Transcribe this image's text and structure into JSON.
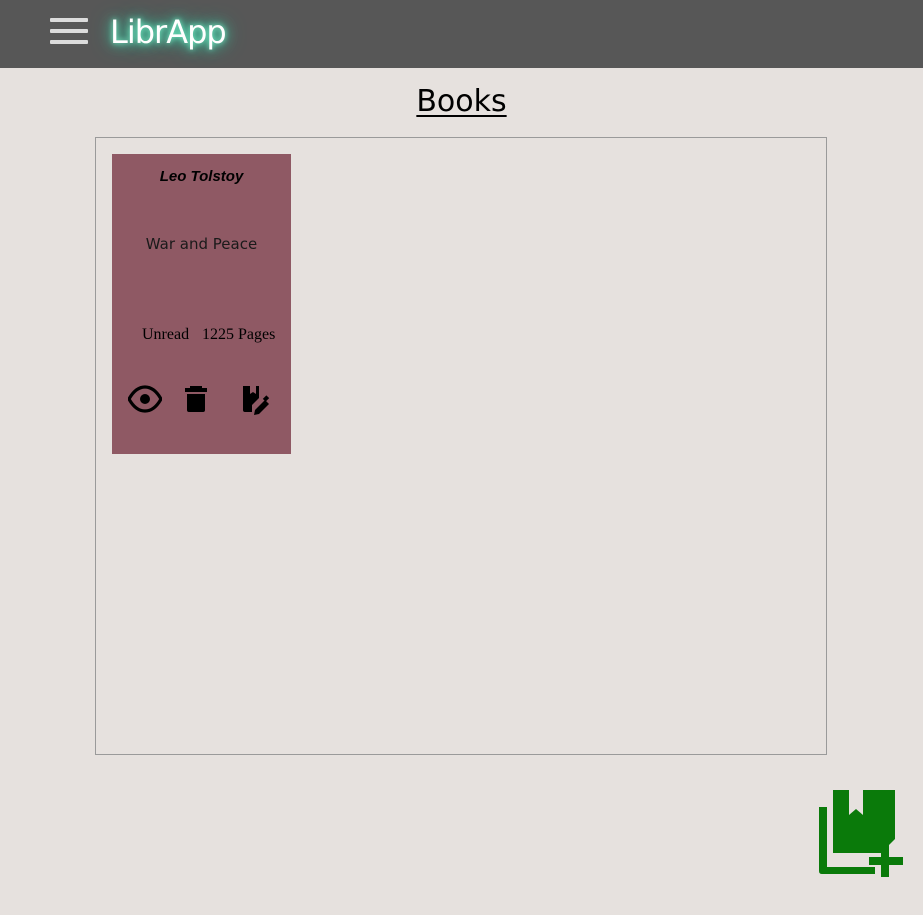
{
  "header": {
    "app_name": "LibrApp",
    "menu_icon": "hamburger-menu-icon"
  },
  "main": {
    "page_title": "Books"
  },
  "books": [
    {
      "author": "Leo Tolstoy",
      "title": "War and Peace",
      "status": "Unread",
      "pages": "1225 Pages",
      "actions": [
        "eye-icon",
        "trash-icon",
        "edit-book-icon"
      ]
    }
  ],
  "fab": {
    "icon": "add-book-icon"
  },
  "colors": {
    "topbar": "#575757",
    "background": "#e6e1de",
    "card": "#8f5964",
    "brand_glow": "#40e0b0",
    "add_button": "#0a7a0a"
  }
}
